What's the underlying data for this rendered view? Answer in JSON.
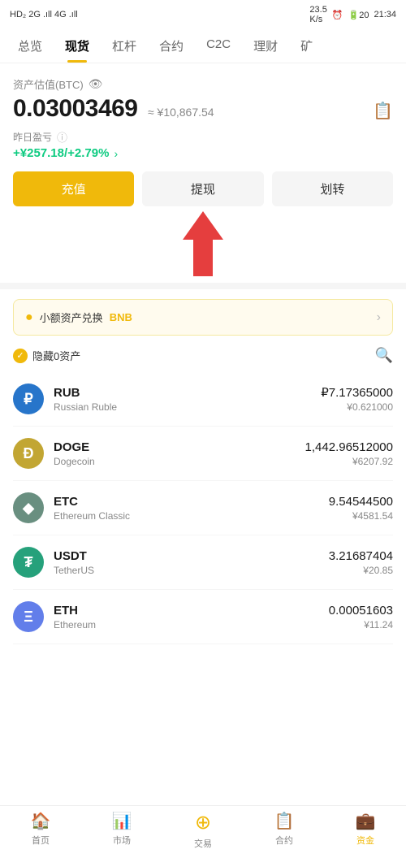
{
  "statusBar": {
    "left": "HD₂ 2G .ıll 4G .ıll",
    "speed": "23.5 K/s",
    "battery": "20",
    "time": "21:34"
  },
  "nav": {
    "tabs": [
      "总览",
      "现货",
      "杠杆",
      "合约",
      "C2C",
      "理财",
      "矿"
    ],
    "active": "现货"
  },
  "asset": {
    "label": "资产估值(BTC)",
    "value": "0.03003469",
    "cny": "≈ ¥10,867.54",
    "pnl_label": "昨日盈亏",
    "pnl_value": "+¥257.18/+2.79%"
  },
  "buttons": {
    "deposit": "充值",
    "withdraw": "提现",
    "transfer": "划转"
  },
  "banner": {
    "text": "小额资产兑换BNB"
  },
  "hideAssets": {
    "label": "隐藏0资产"
  },
  "coins": [
    {
      "symbol": "RUB",
      "name": "Russian Ruble",
      "qty": "₽7.17365000",
      "cny": "¥0.621000",
      "icon": "rub",
      "iconChar": "₽"
    },
    {
      "symbol": "DOGE",
      "name": "Dogecoin",
      "qty": "1,442.96512000",
      "cny": "¥6207.92",
      "icon": "doge",
      "iconChar": "Ð"
    },
    {
      "symbol": "ETC",
      "name": "Ethereum Classic",
      "qty": "9.54544500",
      "cny": "¥4581.54",
      "icon": "etc",
      "iconChar": "◆"
    },
    {
      "symbol": "USDT",
      "name": "TetherUS",
      "qty": "3.21687404",
      "cny": "¥20.85",
      "icon": "usdt",
      "iconChar": "₮"
    },
    {
      "symbol": "ETH",
      "name": "Ethereum",
      "qty": "0.00051603",
      "cny": "¥11.24",
      "icon": "eth",
      "iconChar": "Ξ"
    }
  ],
  "bottomNav": [
    {
      "label": "首页",
      "icon": "🏠",
      "active": false
    },
    {
      "label": "市场",
      "icon": "📊",
      "active": false
    },
    {
      "label": "交易",
      "icon": "🔄",
      "active": false
    },
    {
      "label": "合约",
      "icon": "📋",
      "active": false
    },
    {
      "label": "资金",
      "icon": "💼",
      "active": true
    }
  ]
}
